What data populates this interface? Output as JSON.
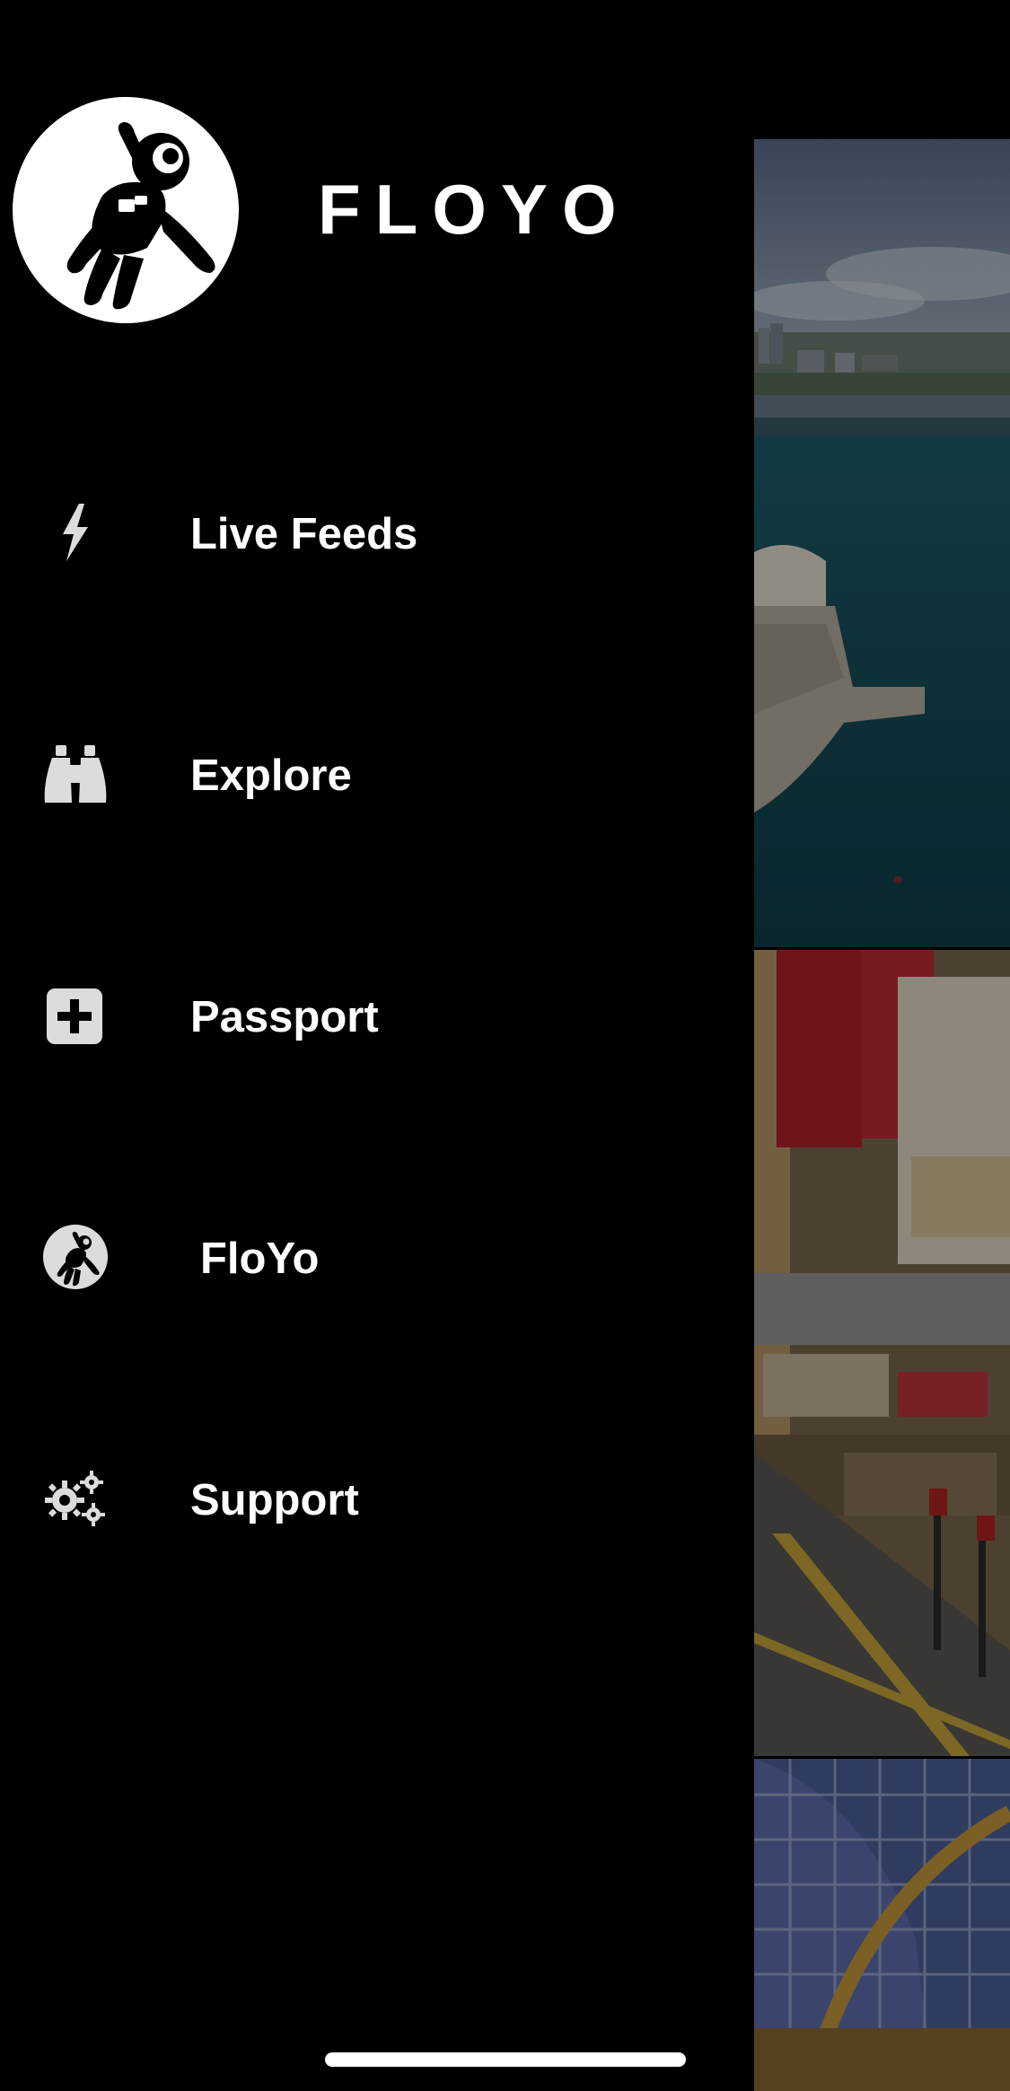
{
  "app": {
    "brand": "FLOYO"
  },
  "menu": {
    "items": [
      {
        "label": "Live Feeds",
        "icon": "lightning-icon"
      },
      {
        "label": "Explore",
        "icon": "binoculars-icon"
      },
      {
        "label": "Passport",
        "icon": "plus-square-icon"
      },
      {
        "label": "FloYo",
        "icon": "astronaut-icon"
      },
      {
        "label": "Support",
        "icon": "gears-icon"
      }
    ]
  },
  "feeds": [
    {
      "scene": "harbour-opera-house-image"
    },
    {
      "scene": "city-street-signs-image"
    },
    {
      "scene": "glass-dome-image"
    }
  ],
  "colors": {
    "background": "#000000",
    "text": "#ffffff",
    "icon": "#dcdcdc"
  }
}
